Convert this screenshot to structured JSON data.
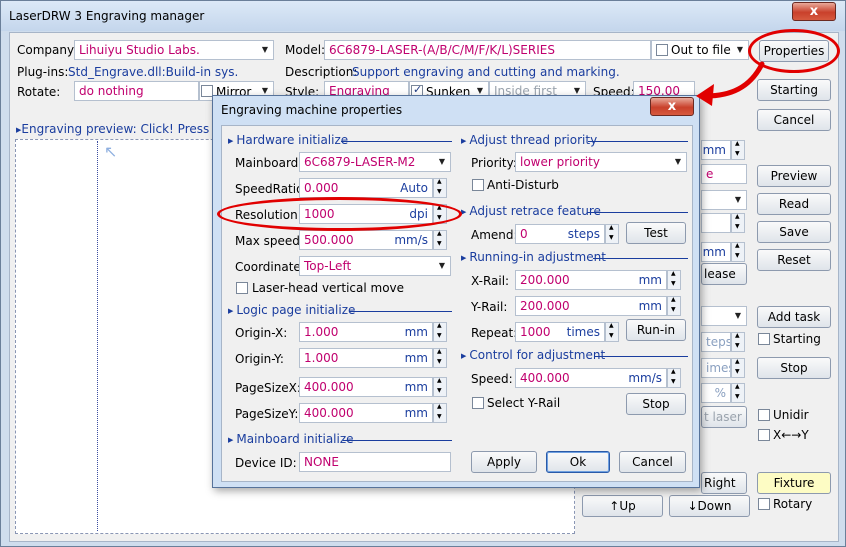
{
  "window": {
    "title": "LaserDRW 3 Engraving manager",
    "close_glyph": "x"
  },
  "main": {
    "company_label": "Company:",
    "company_value": "Lihuiyu Studio Labs.",
    "model_label": "Model:",
    "model_value": "6C6879-LASER-(A/B/C/M/F/K/L)SERIES",
    "out_to_file_label": "Out to file",
    "plugins_label": "Plug-ins:",
    "plugins_value": "Std_Engrave.dll:Build-in sys.",
    "description_label": "Description:",
    "description_value": "Support engraving and cutting and marking.",
    "rotate_label": "Rotate:",
    "rotate_value": "do nothing",
    "mirror_label": "Mirror",
    "style_label": "Style:",
    "style_value": "Engraving",
    "sunken_label": "Sunken",
    "inside_first_value": "Inside first",
    "speed_label": "Speed:",
    "speed_value": "150.00",
    "preview_label": "Engraving preview: Click! Press arro",
    "preview_cursor_glyph": "↖"
  },
  "right_buttons": {
    "properties": "Properties",
    "starting": "Starting",
    "cancel": "Cancel",
    "preview": "Preview",
    "read": "Read",
    "save": "Save",
    "reset": "Reset",
    "add_task": "Add task",
    "starting_check": "Starting",
    "stop": "Stop",
    "unidir": "Unidir",
    "x_y": "X←→Y",
    "fixture": "Fixture",
    "rotary": "Rotary",
    "up": "↑Up",
    "down": "↓Down",
    "right": "Right"
  },
  "partial": {
    "mm1": "mm",
    "e_text": "e",
    "mm2": "mm",
    "lease": "lease",
    "teps": "teps",
    "imes": "imes",
    "pct": "%",
    "t_laser": "t laser"
  },
  "dialog": {
    "title": "Engraving machine properties",
    "close_glyph": "x",
    "hw_section": "Hardware initialize",
    "mainboard_label": "Mainboard:",
    "mainboard_value": "6C6879-LASER-M2",
    "speedratio_label": "SpeedRatio:",
    "speedratio_value": "0.000",
    "speedratio_unit": "Auto",
    "resolution_label": "Resolution:",
    "resolution_value": "1000",
    "resolution_unit": "dpi",
    "maxspeed_label": "Max speed:",
    "maxspeed_value": "500.000",
    "maxspeed_unit": "mm/s",
    "coordinate_label": "Coordinate:",
    "coordinate_value": "Top-Left",
    "laserhead_label": "Laser-head vertical move",
    "logic_section": "Logic page initialize",
    "originx_label": "Origin-X:",
    "originx_value": "1.000",
    "originx_unit": "mm",
    "originy_label": "Origin-Y:",
    "originy_value": "1.000",
    "originy_unit": "mm",
    "pagesizex_label": "PageSizeX:",
    "pagesizex_value": "400.000",
    "pagesizex_unit": "mm",
    "pagesizey_label": "PageSizeY:",
    "pagesizey_value": "400.000",
    "pagesizey_unit": "mm",
    "mb_section": "Mainboard initialize",
    "deviceid_label": "Device ID:",
    "deviceid_value": "NONE",
    "thread_section": "Adjust thread priority",
    "priority_label": "Priority:",
    "priority_value": "lower priority",
    "antidisturb_label": "Anti-Disturb",
    "retrace_section": "Adjust retrace feature",
    "amend_label": "Amend:",
    "amend_value": "0",
    "amend_unit": "steps",
    "test_button": "Test",
    "runin_section": "Running-in adjustment",
    "xrail_label": "X-Rail:",
    "xrail_value": "200.000",
    "xrail_unit": "mm",
    "yrail_label": "Y-Rail:",
    "yrail_value": "200.000",
    "yrail_unit": "mm",
    "repeat_label": "Repeat:",
    "repeat_value": "1000",
    "repeat_unit": "times",
    "runin_button": "Run-in",
    "control_section": "Control for adjustment",
    "speed_label": "Speed:",
    "speed_value": "400.000",
    "speed_unit": "mm/s",
    "select_yrail_label": "Select Y-Rail",
    "stop_button": "Stop",
    "apply_button": "Apply",
    "ok_button": "Ok",
    "cancel_button": "Cancel"
  },
  "colors": {
    "annotation": "#e10000",
    "section": "#1a3d9e",
    "value": "#c0006e"
  }
}
